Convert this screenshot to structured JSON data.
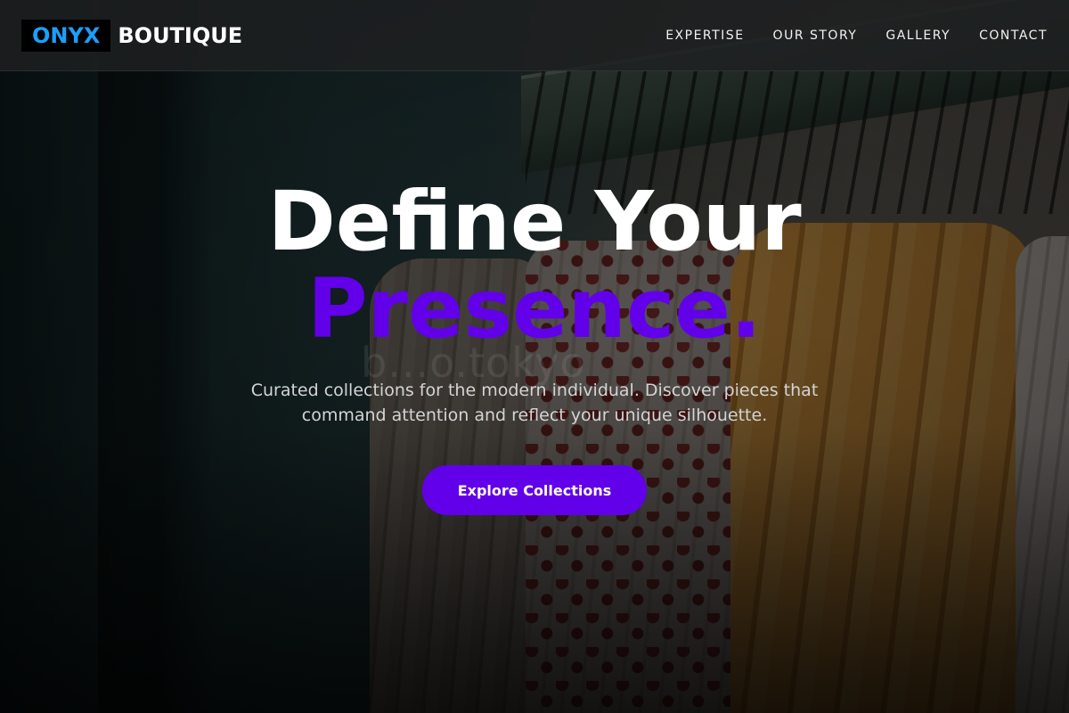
{
  "brand": {
    "mark": "ONYX",
    "word": "BOUTIQUE"
  },
  "nav": {
    "items": [
      {
        "label": "EXPERTISE"
      },
      {
        "label": "OUR STORY"
      },
      {
        "label": "GALLERY"
      },
      {
        "label": "CONTACT"
      }
    ]
  },
  "hero": {
    "headline_line1": "Define Your",
    "headline_line2": "Presence.",
    "subtext": "Curated collections for the modern individual. Discover pieces that command attention and reflect your unique silhouette.",
    "cta_label": "Explore Collections",
    "watermark": "b...o.tokyo"
  },
  "colors": {
    "accent": "#6200ea",
    "logo_blue": "#1a9fff"
  }
}
